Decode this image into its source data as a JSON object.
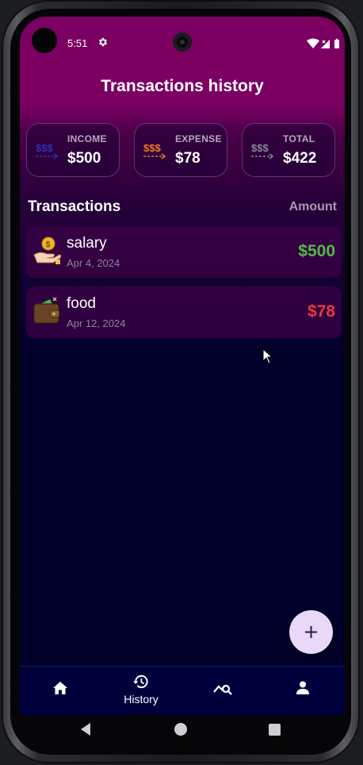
{
  "status_bar": {
    "time": "5:51"
  },
  "header": {
    "title": "Transactions history"
  },
  "summary": [
    {
      "label": "INCOME",
      "value": "$500",
      "icon": "income-money-icon",
      "color": "#2f2fb0"
    },
    {
      "label": "EXPENSE",
      "value": "$78",
      "icon": "expense-money-icon",
      "color": "#f07a22"
    },
    {
      "label": "TOTAL",
      "value": "$422",
      "icon": "total-money-icon",
      "color": "#8a8794"
    }
  ],
  "section": {
    "title": "Transactions",
    "amount_header": "Amount"
  },
  "transactions": [
    {
      "title": "salary",
      "date": "Apr 4, 2024",
      "amount": "$500",
      "icon": "salary-hand-coin-icon",
      "amount_color": "#55b847"
    },
    {
      "title": "food",
      "date": "Apr 12, 2024",
      "amount": "$78",
      "icon": "wallet-icon",
      "amount_color": "#e53a3f"
    }
  ],
  "fab": {
    "icon": "plus-icon"
  },
  "bottom_nav": {
    "items": [
      {
        "icon": "home-icon",
        "label": ""
      },
      {
        "icon": "history-icon",
        "label": "History",
        "active": true
      },
      {
        "icon": "chart-search-icon",
        "label": ""
      },
      {
        "icon": "profile-icon",
        "label": ""
      }
    ]
  },
  "colors": {
    "header_bg": "#7b0062",
    "screen_bg": "#02002b",
    "income_green": "#55b847",
    "expense_red": "#e53a3f",
    "fab_bg": "#ead8fb"
  }
}
